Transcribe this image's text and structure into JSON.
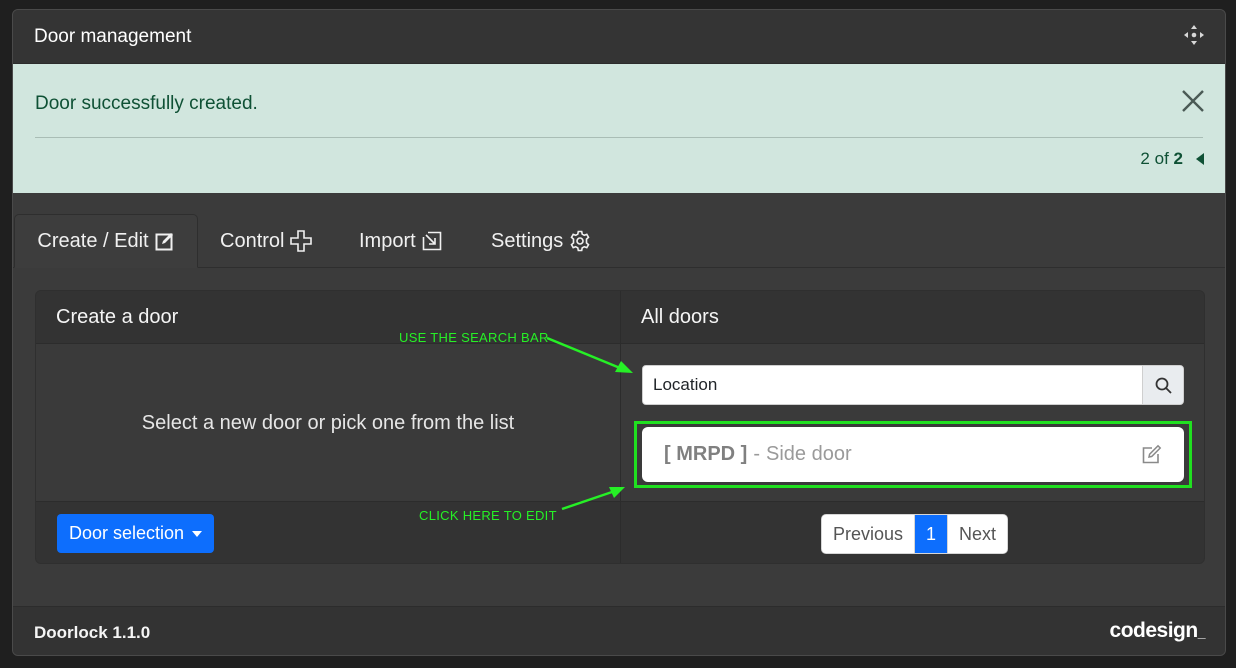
{
  "window": {
    "title": "Door management"
  },
  "alert": {
    "message": "Door successfully created.",
    "pager_current": "2",
    "pager_of": "of",
    "pager_total": "2"
  },
  "tabs": [
    {
      "label": "Create / Edit",
      "icon": "edit-icon",
      "active": true
    },
    {
      "label": "Control",
      "icon": "control-pad-icon",
      "active": false
    },
    {
      "label": "Import",
      "icon": "import-icon",
      "active": false
    },
    {
      "label": "Settings",
      "icon": "gear-icon",
      "active": false
    }
  ],
  "create_panel": {
    "header": "Create a door",
    "empty_message": "Select a new door or pick one from the list",
    "selection_button": "Door selection"
  },
  "doors_panel": {
    "header": "All doors",
    "search_placeholder": "Location",
    "doors": [
      {
        "code": "[ MRPD ]",
        "separator": "-",
        "name": "Side door"
      }
    ],
    "pagination": {
      "previous": "Previous",
      "page": "1",
      "next": "Next"
    }
  },
  "annotations": {
    "search_hint": "USE THE SEARCH BAR",
    "edit_hint": "CLICK HERE TO EDIT",
    "color": "#26f026"
  },
  "footer": {
    "version": "Doorlock 1.1.0",
    "brand": "codesign"
  },
  "colors": {
    "alert_bg": "#d1e6de",
    "alert_text": "#0f5135",
    "primary": "#0d6efd",
    "panel_bg": "#3b3b3b"
  }
}
